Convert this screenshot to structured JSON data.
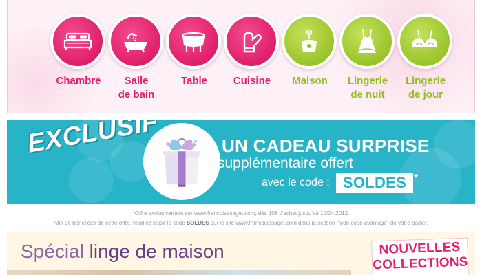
{
  "categories": [
    {
      "label": "Chambre",
      "icon": "bed-icon",
      "color": "pink"
    },
    {
      "label": "Salle\nde bain",
      "icon": "bathtub-icon",
      "color": "pink"
    },
    {
      "label": "Table",
      "icon": "table-icon",
      "color": "pink"
    },
    {
      "label": "Cuisine",
      "icon": "oven-mitt-icon",
      "color": "pink"
    },
    {
      "label": "Maison",
      "icon": "candle-icon",
      "color": "green"
    },
    {
      "label": "Lingerie\nde nuit",
      "icon": "nightgown-icon",
      "color": "green"
    },
    {
      "label": "Lingerie\nde jour",
      "icon": "bra-icon",
      "color": "green"
    }
  ],
  "colors": {
    "pink": "#e01f6d",
    "green": "#94bd21",
    "promo_bg": "#27b3c8",
    "purple": "#7a4c96"
  },
  "promo": {
    "badge": "EXCLUSIF",
    "line1": "UN CADEAU SURPRISE",
    "line2": "supplémentaire offert",
    "line3": "avec le code :",
    "code": "SOLDES",
    "asterisk": "*",
    "icon": "gift-icon"
  },
  "disclaimer": {
    "line1": "*Offre exclusivement sur www.francoisesaget.com, dès 10€ d'achat jusqu'au 10/04/2012.",
    "line2_prefix": "Afin de bénéficier de cette offre, veuillez saisir le code ",
    "line2_code": "SOLDES",
    "line2_suffix": " sur le site www.francoisesaget.com dans la section \"Mon code avantage\" de votre panier."
  },
  "special": {
    "title_light": "Spécial",
    "title_strong": "linge de maison",
    "badge_line1": "NOUVELLES",
    "badge_line2": "COLLECTIONS"
  }
}
